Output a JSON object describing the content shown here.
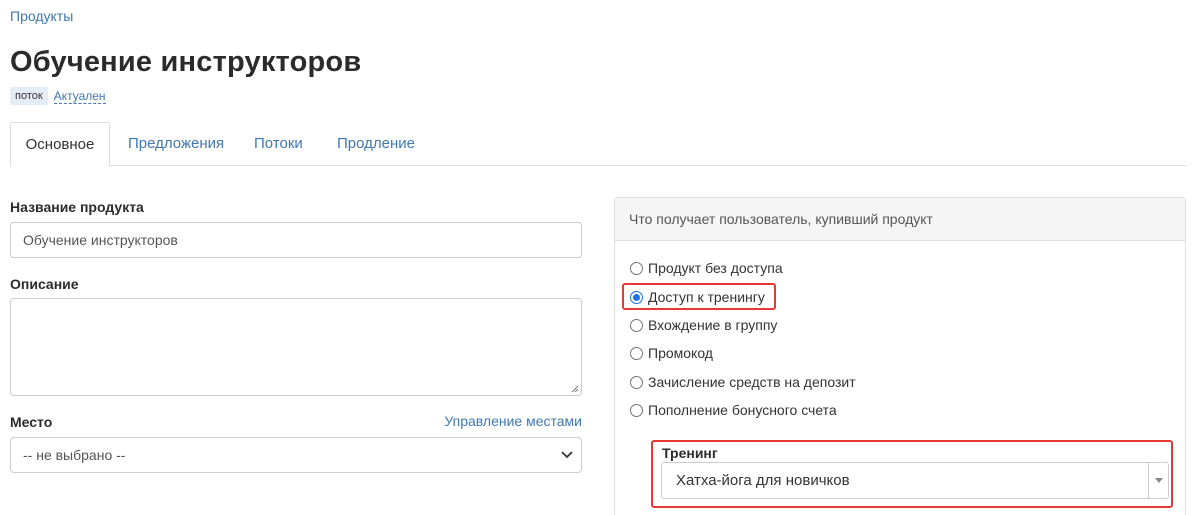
{
  "breadcrumb": {
    "label": "Продукты"
  },
  "page": {
    "title": "Обучение инструкторов"
  },
  "badges": {
    "type": "поток",
    "status": "Актуален"
  },
  "tabs": [
    {
      "label": "Основное",
      "active": true
    },
    {
      "label": "Предложения",
      "active": false
    },
    {
      "label": "Потоки",
      "active": false
    },
    {
      "label": "Продление",
      "active": false
    }
  ],
  "form": {
    "name": {
      "label": "Название продукта",
      "value": "Обучение инструкторов"
    },
    "description": {
      "label": "Описание",
      "value": ""
    },
    "place": {
      "label": "Место",
      "manage_link": "Управление местами",
      "selected": "-- не выбрано --"
    }
  },
  "access_panel": {
    "header": "Что получает пользователь, купивший продукт",
    "options": [
      {
        "label": "Продукт без доступа",
        "checked": false
      },
      {
        "label": "Доступ к тренингу",
        "checked": true
      },
      {
        "label": "Вхождение в группу",
        "checked": false
      },
      {
        "label": "Промокод",
        "checked": false
      },
      {
        "label": "Зачисление средств на депозит",
        "checked": false
      },
      {
        "label": "Пополнение бонусного счета",
        "checked": false
      }
    ],
    "training": {
      "label": "Тренинг",
      "selected": "Хатха-йога для новичков"
    }
  },
  "colors": {
    "link": "#3f78b2",
    "highlight": "#e53935",
    "radio_checked": "#1a73e8"
  }
}
